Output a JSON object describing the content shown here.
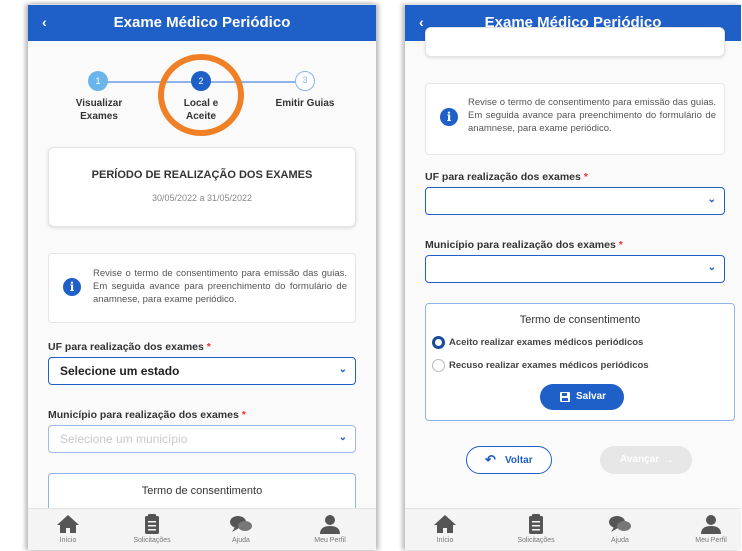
{
  "app": {
    "title": "Exame Médico Periódico",
    "back": "‹"
  },
  "stepper": {
    "steps": [
      {
        "number": "1",
        "label_line1": "Visualizar",
        "label_line2": "Exames"
      },
      {
        "number": "2",
        "label_line1": "Local e",
        "label_line2": "Aceite"
      },
      {
        "number": "3",
        "label_line1": "Emitir Guias",
        "label_line2": ""
      }
    ],
    "highlight_color": "#f08025"
  },
  "period": {
    "title": "PERÍODO DE REALIZAÇÃO DOS EXAMES",
    "dates": "30/05/2022 a 31/05/2022"
  },
  "info": {
    "icon": "i",
    "text": "Revise o termo de consentimento para emissão das guias. Em seguida avance para preenchimento do formulário de anamnese, para exame periódico."
  },
  "uf": {
    "label": "UF para realização dos exames",
    "required": "*",
    "value": "Selecione um estado",
    "value_right": ""
  },
  "municipio": {
    "label": "Município para realização dos exames",
    "required": "*",
    "placeholder": "Selecione um município",
    "value_right": ""
  },
  "consent": {
    "title": "Termo de consentimento",
    "options": [
      "Aceito realizar exames médicos periódicos",
      "Recuso realizar exames médicos periódicos"
    ],
    "selected_index": 0,
    "save_label": "Salvar"
  },
  "nav": {
    "back_label": "Voltar",
    "next_label": "Avançar"
  },
  "tabbar": {
    "items": [
      {
        "label": "Início",
        "icon": "home-icon"
      },
      {
        "label": "Solicitações",
        "icon": "clipboard-icon"
      },
      {
        "label": "Ajuda",
        "icon": "chat-icon"
      },
      {
        "label": "Meu Perfil",
        "icon": "user-icon"
      }
    ]
  },
  "colors": {
    "primary": "#1f5fc8",
    "highlight": "#f08025",
    "required": "#e33333"
  }
}
